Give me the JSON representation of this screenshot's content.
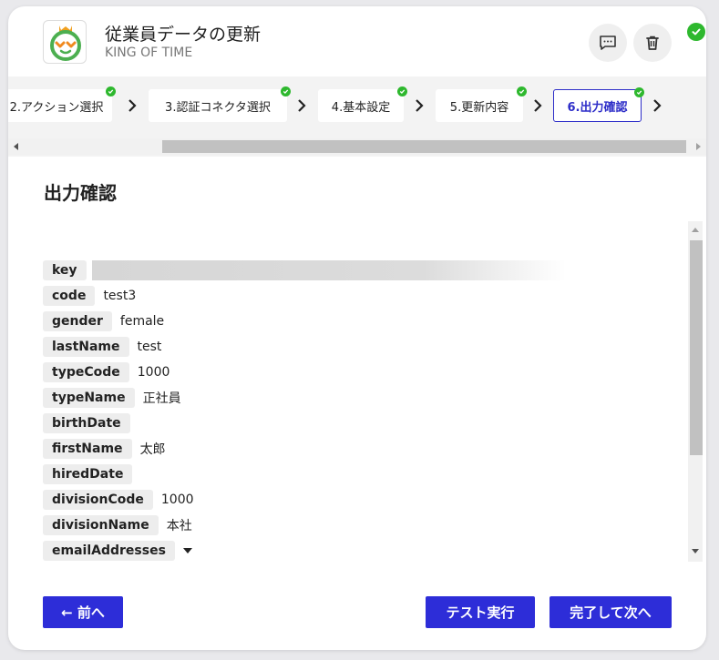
{
  "header": {
    "title": "従業員データの更新",
    "subtitle": "KING OF TIME",
    "app_icon": "king-of-time-logo",
    "comment_icon": "comment-icon",
    "delete_icon": "trash-icon",
    "status_icon": "check-circle-icon"
  },
  "steps": [
    {
      "label": "2.アクション選択",
      "done": true,
      "active": false
    },
    {
      "label": "3.認証コネクタ選択",
      "done": true,
      "active": false
    },
    {
      "label": "4.基本設定",
      "done": true,
      "active": false
    },
    {
      "label": "5.更新内容",
      "done": true,
      "active": false
    },
    {
      "label": "6.出力確認",
      "done": true,
      "active": true
    }
  ],
  "section": {
    "title": "出力確認"
  },
  "fields": [
    {
      "key": "key",
      "value": ""
    },
    {
      "key": "code",
      "value": "test3"
    },
    {
      "key": "gender",
      "value": "female"
    },
    {
      "key": "lastName",
      "value": "test"
    },
    {
      "key": "typeCode",
      "value": "1000"
    },
    {
      "key": "typeName",
      "value": "正社員"
    },
    {
      "key": "birthDate",
      "value": ""
    },
    {
      "key": "firstName",
      "value": "太郎"
    },
    {
      "key": "hiredDate",
      "value": ""
    },
    {
      "key": "divisionCode",
      "value": "1000"
    },
    {
      "key": "divisionName",
      "value": "本社"
    },
    {
      "key": "emailAddresses",
      "value": ""
    }
  ],
  "buttons": {
    "back": "← 前へ",
    "test": "テスト実行",
    "next": "完了して次へ"
  },
  "colors": {
    "accent": "#2d2dd8",
    "success": "#2eb82e"
  }
}
